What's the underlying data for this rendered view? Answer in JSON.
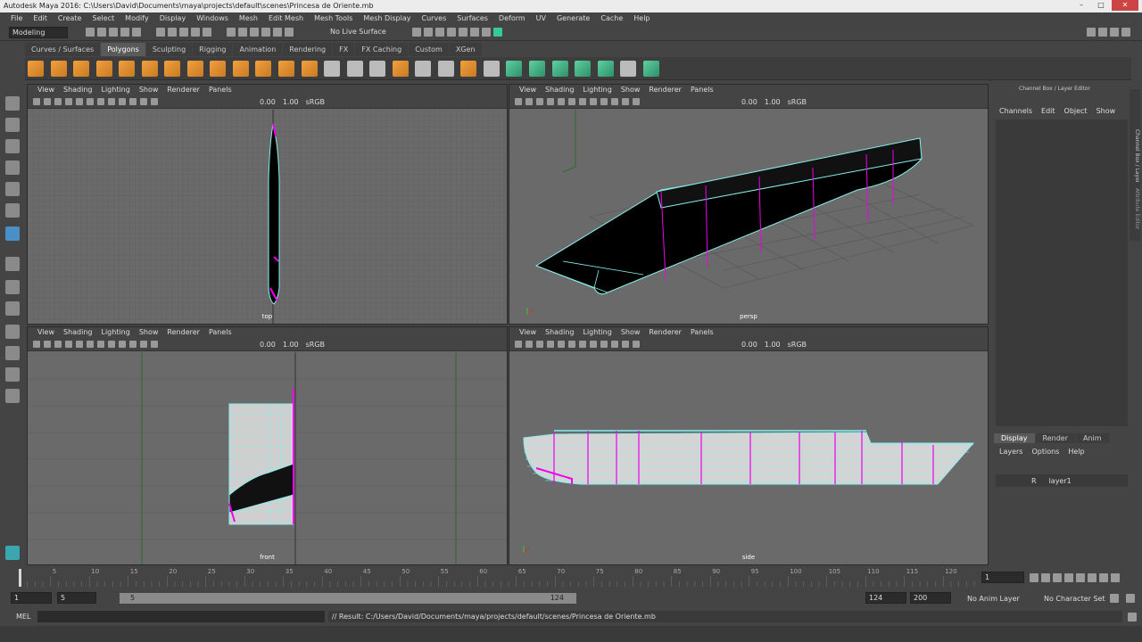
{
  "window": {
    "title": "Autodesk Maya 2016: C:\\Users\\David\\Documents\\maya\\projects\\default\\scenes\\Princesa de Oriente.mb"
  },
  "menu": [
    "File",
    "Edit",
    "Create",
    "Select",
    "Modify",
    "Display",
    "Windows",
    "Mesh",
    "Edit Mesh",
    "Mesh Tools",
    "Mesh Display",
    "Curves",
    "Surfaces",
    "Deform",
    "UV",
    "Generate",
    "Cache",
    "Help"
  ],
  "status": {
    "mode": "Modeling",
    "live_surface": "No Live Surface"
  },
  "shelf_tabs": [
    "Curves / Surfaces",
    "Polygons",
    "Sculpting",
    "Rigging",
    "Animation",
    "Rendering",
    "FX",
    "FX Caching",
    "Custom",
    "XGen"
  ],
  "panel_menu": [
    "View",
    "Shading",
    "Lighting",
    "Show",
    "Renderer",
    "Panels"
  ],
  "panel_values": {
    "exposure": "0.00",
    "gamma": "1.00",
    "srgb": "sRGB"
  },
  "viewports": {
    "top": "top",
    "persp": "persp",
    "front": "front",
    "side": "side"
  },
  "channel_box": {
    "title": "Channel Box / Layer Editor",
    "menu": [
      "Channels",
      "Edit",
      "Object",
      "Show"
    ]
  },
  "side_tabs": {
    "a": "Channel Box / Layer Editor",
    "b": "Attribute Editor"
  },
  "layer_editor": {
    "tabs": [
      "Display",
      "Render",
      "Anim"
    ],
    "menu": [
      "Layers",
      "Options",
      "Help"
    ],
    "layer": {
      "flag": "R",
      "name": "layer1"
    }
  },
  "timeline": {
    "ticks": [
      "5",
      "10",
      "15",
      "20",
      "25",
      "30",
      "35",
      "40",
      "45",
      "50",
      "55",
      "60",
      "65",
      "70",
      "75",
      "80",
      "85",
      "90",
      "95",
      "100",
      "105",
      "110",
      "115",
      "120"
    ],
    "current": "1"
  },
  "range": {
    "start": "1",
    "start2": "5",
    "slider_start": "5",
    "slider_end": "124",
    "end": "124",
    "end2": "200",
    "anim_layer": "No Anim Layer",
    "char_set": "No Character Set"
  },
  "cmdline": {
    "label": "MEL",
    "result": "// Result: C:/Users/David/Documents/maya/projects/default/scenes/Princesa de Oriente.mb"
  }
}
